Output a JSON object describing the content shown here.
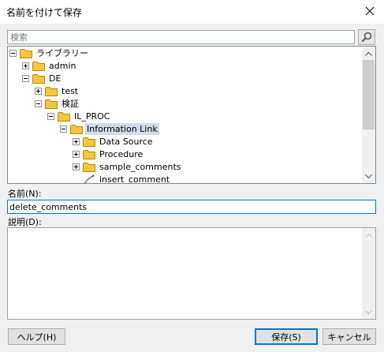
{
  "window": {
    "title": "名前を付けて保存",
    "close_icon": "close-icon"
  },
  "search": {
    "placeholder": "検索",
    "value": ""
  },
  "tree": {
    "items": [
      {
        "label": "ライブラリー",
        "expander": "minus",
        "selected": false
      },
      {
        "label": "admin",
        "expander": "plus",
        "selected": false
      },
      {
        "label": "DE",
        "expander": "minus",
        "selected": false
      },
      {
        "label": "test",
        "expander": "plus",
        "selected": false
      },
      {
        "label": "検証",
        "expander": "minus",
        "selected": false
      },
      {
        "label": "IL_PROC",
        "expander": "minus",
        "selected": false
      },
      {
        "label": "Information Link",
        "expander": "minus",
        "selected": true
      },
      {
        "label": "Data Source",
        "expander": "plus",
        "selected": false
      },
      {
        "label": "Procedure",
        "expander": "plus",
        "selected": false
      },
      {
        "label": "sample_comments",
        "expander": "plus",
        "selected": false
      },
      {
        "label": "insert_comment",
        "expander": "none",
        "icon": "procedure-icon",
        "selected": false
      }
    ]
  },
  "name": {
    "label": "名前(N):",
    "value": "delete_comments"
  },
  "description": {
    "label": "説明(D):",
    "value": ""
  },
  "buttons": {
    "help": "ヘルプ(H)",
    "save": "保存(S)",
    "cancel": "キャンセル"
  },
  "colors": {
    "folder": "#f5c542",
    "selection": "#cfdbe8",
    "focus": "#0078d7"
  }
}
